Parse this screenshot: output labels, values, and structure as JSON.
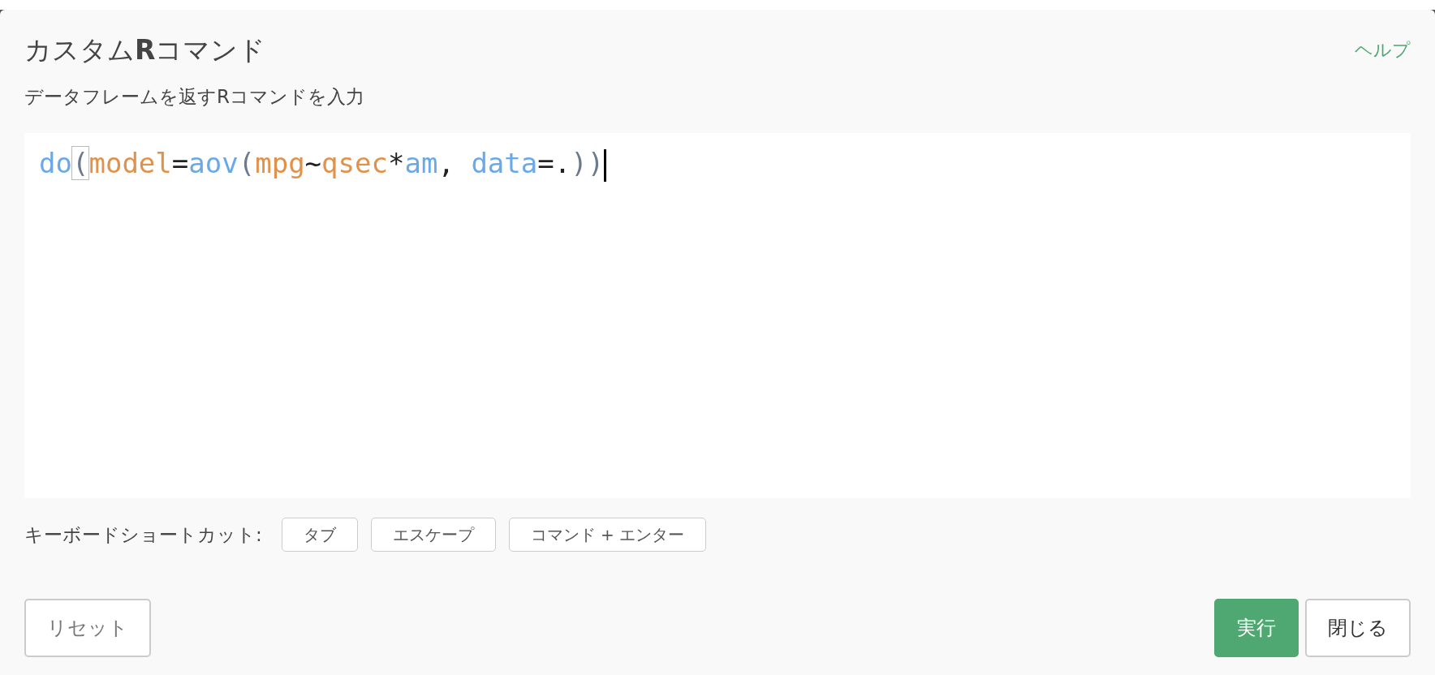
{
  "dialog": {
    "title": "カスタム**R**コマンド",
    "help_link": "ヘルプ",
    "subtitle": "データフレームを返すRコマンドを入力"
  },
  "editor": {
    "tokens": [
      {
        "text": "do",
        "kind": "function",
        "matched": false
      },
      {
        "text": "(",
        "kind": "paren",
        "matched": true
      },
      {
        "text": "model",
        "kind": "argument",
        "matched": false
      },
      {
        "text": "=",
        "kind": "operator",
        "matched": false
      },
      {
        "text": "aov",
        "kind": "function",
        "matched": false
      },
      {
        "text": "(",
        "kind": "paren",
        "matched": false
      },
      {
        "text": "mpg",
        "kind": "argument",
        "matched": false
      },
      {
        "text": "~",
        "kind": "operator",
        "matched": false
      },
      {
        "text": "qsec",
        "kind": "argument",
        "matched": false
      },
      {
        "text": "*",
        "kind": "operator",
        "matched": false
      },
      {
        "text": "am",
        "kind": "function",
        "matched": false
      },
      {
        "text": ", ",
        "kind": "operator",
        "matched": false
      },
      {
        "text": "data",
        "kind": "function",
        "matched": false
      },
      {
        "text": "=",
        "kind": "operator",
        "matched": false
      },
      {
        "text": ".",
        "kind": "operator",
        "matched": false
      },
      {
        "text": ")",
        "kind": "paren",
        "matched": false
      },
      {
        "text": ")",
        "kind": "paren",
        "matched": false
      }
    ]
  },
  "shortcuts": {
    "label": "キーボードショートカット:",
    "keys": [
      "タブ",
      "エスケープ",
      "コマンド + エンター"
    ]
  },
  "footer": {
    "reset": "リセット",
    "buttons": [
      {
        "label": "実行",
        "kind": "primary"
      },
      {
        "label": "閉じる",
        "kind": "secondary"
      }
    ]
  }
}
